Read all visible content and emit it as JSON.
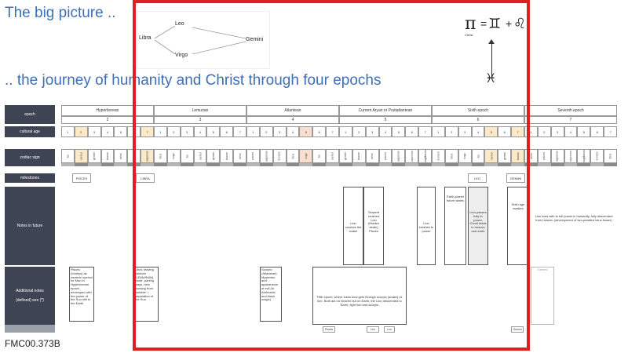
{
  "title_main": "The big picture ..",
  "title_sub": ".. the journey of humanity and Christ through four epochs",
  "footer_code": "FMC00.373B",
  "diagram_left": {
    "libra": "Libra",
    "leo": "Leo",
    "virgo": "Virgo",
    "gemini": "Gemini"
  },
  "diagram_right": {
    "pi": "π",
    "equals": "=",
    "gemini_glyph": "♊",
    "plus": "+",
    "leo_glyph": "♌",
    "christ": "Christ",
    "pisces_glyph": "♓"
  },
  "row_labels": {
    "epoch": "epoch",
    "cultural_age": "cultural age",
    "zodiac_sign": "zodiac sign",
    "milestones": "milestones",
    "notes_in_future": "Notes in future",
    "additional_notes": "Additional notes",
    "defined_sub": "(defined) see (*)"
  },
  "epochs": [
    {
      "name": "Hyperborean",
      "num": "2"
    },
    {
      "name": "Lemurian",
      "num": "3"
    },
    {
      "name": "Atlantean",
      "num": "4"
    },
    {
      "name": "Current Aryan or Postatlantean",
      "num": "5"
    },
    {
      "name": "Sixth epoch",
      "num": "6"
    },
    {
      "name": "Seventh epoch",
      "num": "7"
    }
  ],
  "ages": [
    "1",
    "2",
    "3",
    "4",
    "5",
    "6",
    "7",
    "1",
    "2",
    "3",
    "4",
    "5",
    "6",
    "7",
    "1",
    "2",
    "3",
    "4",
    "5",
    "6",
    "7",
    "1",
    "2",
    "3",
    "4",
    "5",
    "6",
    "7",
    "1",
    "2",
    "3",
    "4",
    "5",
    "6",
    "7",
    "1",
    "2",
    "3",
    "4",
    "5",
    "6",
    "7"
  ],
  "signs": [
    "leo",
    "cancer",
    "gemini",
    "taurus",
    "aries",
    "pisces",
    "aquarius",
    "libra",
    "virgo",
    "leo",
    "cancer",
    "gemini",
    "taurus",
    "aries",
    "pisces",
    "aquarius",
    "scorpio",
    "libra",
    "virgo",
    "leo",
    "cancer",
    "gemini",
    "taurus",
    "aries",
    "pisces",
    "aquarius",
    "capricorn",
    "sagittarius",
    "scorpio",
    "libra",
    "virgo",
    "leo",
    "cancer",
    "gemini",
    "taurus",
    "aries",
    "pisces",
    "aquarius",
    "capricorn",
    "sagittarius",
    "scorpio",
    "libra"
  ],
  "milestones": {
    "pisces": "PISCES",
    "libra": "LIBRA",
    "leo": "LEO",
    "gemini": "GEMINI"
  },
  "notes_future": {
    "n1": "Lion crushes the snake",
    "n2": "Serpent crushed Lion (Hidden death) Pisces",
    "n3": "Lion crushes to power",
    "n4": "Earth-planet future states",
    "n5": "Lion passes fully to power, Christ leads to heaven and earth",
    "n6": "Sixth age awakes",
    "n7": "Lion lives with to full power in humanity, fully descended from heaven (development of two-petalled lotus flower)"
  },
  "additional": {
    "a1": "Pisces (Ichthys) as esoteric symbol for Man in Hyperborean epoch, developed with the power of the Sun still in the Earth",
    "a2": "Libra: leaving balance (LEMURIAN) Node, parting ways, new working from 'outside' = separation of the Sun",
    "a3": "Scorpio (Atlantean) Mysteries and appearance of evil (in Ahrimanic and black magic)",
    "a4": "Fifth epoch: where loses soul gets through scorpio (snake) vs lion. Both act on heaven but on Earth, the Lion descended to Earth, fight lion and scorpio",
    "a5": "Gemini"
  },
  "bottom_tags": {
    "t1": "Pisces",
    "t2": "Leo",
    "t3": "Leo",
    "t4": "Gemini"
  }
}
